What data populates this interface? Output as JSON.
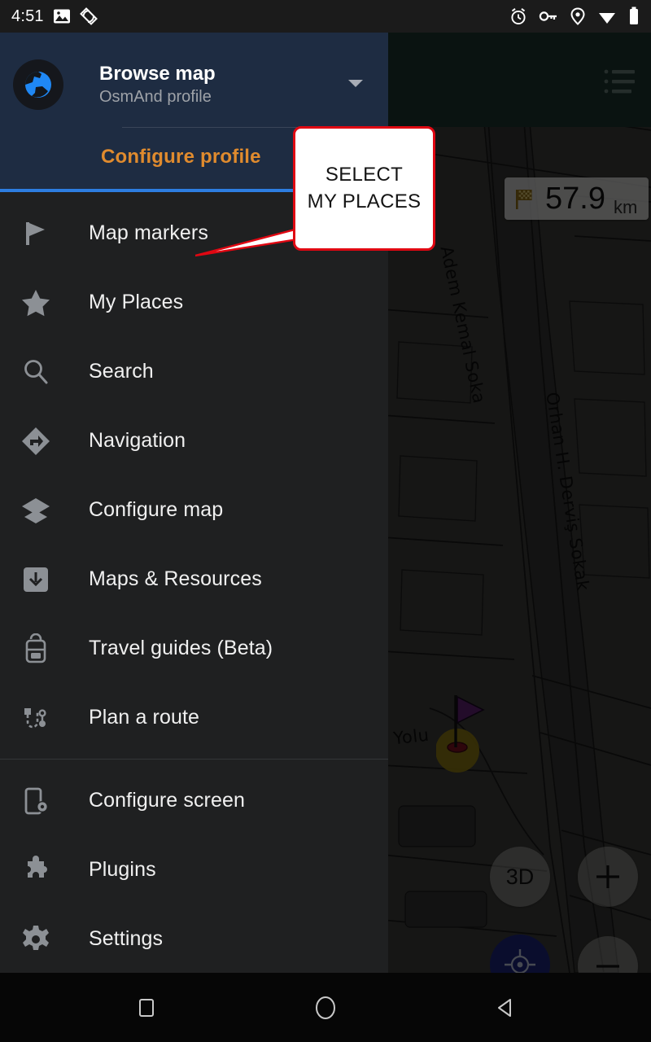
{
  "status_bar": {
    "time": "4:51",
    "left_icons": [
      "image-icon",
      "screen-rotation-icon"
    ],
    "right_icons": [
      "alarm-icon",
      "vpn-key-icon",
      "location-icon",
      "wifi-icon",
      "battery-icon"
    ]
  },
  "drawer": {
    "profile": {
      "avatar_icon": "globe-icon",
      "title": "Browse map",
      "subtitle": "OsmAnd profile",
      "dropdown_icon": "chevron-down-icon"
    },
    "configure_profile_label": "Configure profile",
    "accent_color": "#2d7de0",
    "configure_profile_color": "#e08b2e",
    "header_bg": "#1e2c42",
    "menu_groups": [
      {
        "items": [
          {
            "icon": "flag-icon",
            "label": "Map markers"
          },
          {
            "icon": "star-icon",
            "label": "My Places"
          },
          {
            "icon": "search-icon",
            "label": "Search"
          },
          {
            "icon": "navigation-icon",
            "label": "Navigation"
          },
          {
            "icon": "layers-icon",
            "label": "Configure map"
          },
          {
            "icon": "download-icon",
            "label": "Maps & Resources"
          },
          {
            "icon": "backpack-icon",
            "label": "Travel guides (Beta)"
          },
          {
            "icon": "route-icon",
            "label": "Plan a route"
          }
        ]
      },
      {
        "items": [
          {
            "icon": "screen-settings-icon",
            "label": "Configure screen"
          },
          {
            "icon": "puzzle-icon",
            "label": "Plugins"
          },
          {
            "icon": "gear-icon",
            "label": "Settings"
          }
        ]
      }
    ]
  },
  "callout": {
    "line1": "SELECT",
    "line2": "MY PLACES",
    "border_color": "#e00712",
    "background": "#ffffff"
  },
  "map": {
    "distance_widget": {
      "icon": "checkered-flag-icon",
      "value": "57.9",
      "unit": "km"
    },
    "street_labels": [
      "Adem Kemal Soka",
      "Orhan H. Derviş Sokak",
      "r Yolu"
    ],
    "marker": {
      "icon": "purple-flag-marker"
    },
    "controls": [
      {
        "name": "3d-button",
        "label": "3D"
      },
      {
        "name": "zoom-in-button",
        "label": "+"
      },
      {
        "name": "zoom-out-button",
        "label": "−"
      },
      {
        "name": "my-location-button",
        "label": "",
        "color": "#1b2477"
      }
    ],
    "overlay_list_icon": "list-icon"
  },
  "nav_bar": {
    "buttons": [
      "recents-square-icon",
      "home-circle-icon",
      "back-triangle-icon"
    ]
  }
}
